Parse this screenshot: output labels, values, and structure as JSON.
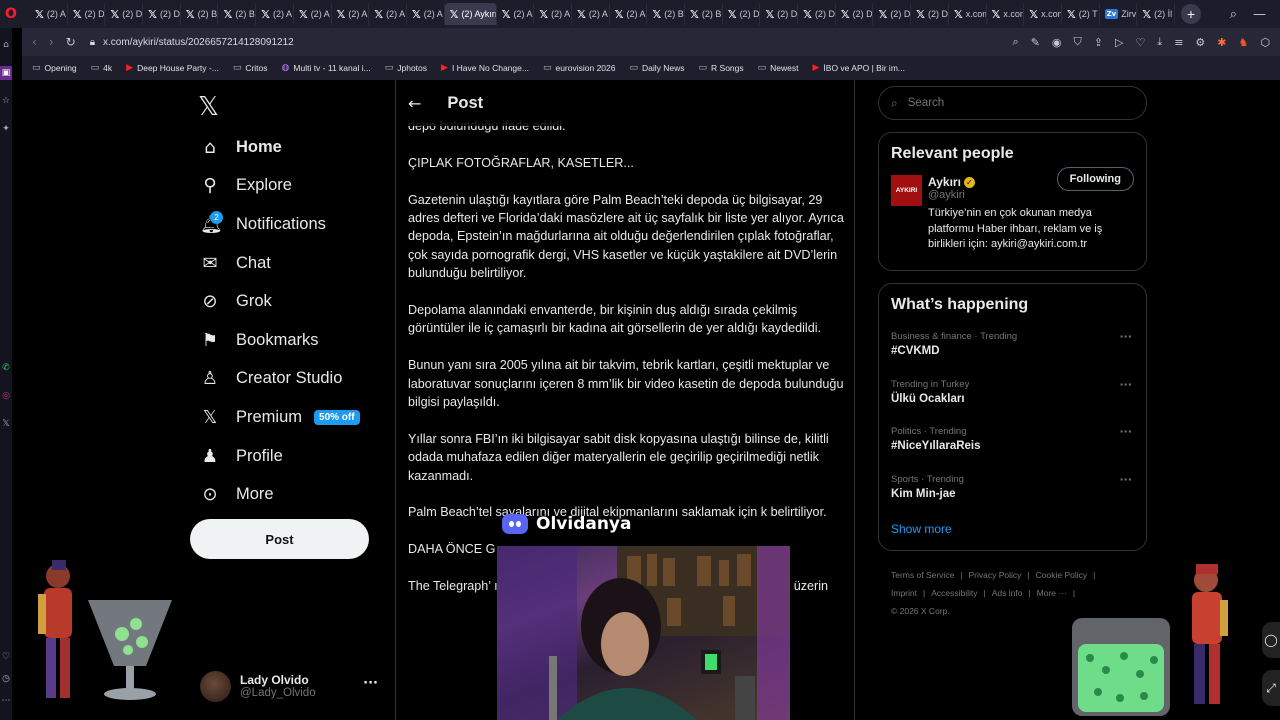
{
  "browser": {
    "tabs": [
      {
        "label": "(2) A"
      },
      {
        "label": "(2) D"
      },
      {
        "label": "(2) D"
      },
      {
        "label": "(2) D"
      },
      {
        "label": "(2) B"
      },
      {
        "label": "(2) B"
      },
      {
        "label": "(2) A"
      },
      {
        "label": "(2) A"
      },
      {
        "label": "(2) A"
      },
      {
        "label": "(2) A"
      },
      {
        "label": "(2) A"
      },
      {
        "label": "(2) Aykırı",
        "active": true
      },
      {
        "label": "(2) A"
      },
      {
        "label": "(2) A"
      },
      {
        "label": "(2) A"
      },
      {
        "label": "(2) A"
      },
      {
        "label": "(2) B"
      },
      {
        "label": "(2) B"
      },
      {
        "label": "(2) D"
      },
      {
        "label": "(2) D"
      },
      {
        "label": "(2) D"
      },
      {
        "label": "(2) D"
      },
      {
        "label": "(2) D"
      },
      {
        "label": "(2) D"
      },
      {
        "label": "x.com"
      },
      {
        "label": "x.com"
      },
      {
        "label": "x.com"
      },
      {
        "label": "(2) T"
      },
      {
        "label": "Zirve",
        "blue": true
      },
      {
        "label": "(2) İl"
      }
    ],
    "url": "x.com/aykiri/status/2026657214128091212",
    "bookmarks": [
      {
        "label": "Opening",
        "icon": "folder"
      },
      {
        "label": "4k",
        "icon": "folder"
      },
      {
        "label": "Deep House Party -...",
        "icon": "youtube"
      },
      {
        "label": "Critos",
        "icon": "folder"
      },
      {
        "label": "Multi tv - 11 kanal i...",
        "icon": "vk"
      },
      {
        "label": "Jphotos",
        "icon": "folder"
      },
      {
        "label": "I Have No Change...",
        "icon": "youtube"
      },
      {
        "label": "eurovision 2026",
        "icon": "folder"
      },
      {
        "label": "Daily News",
        "icon": "folder"
      },
      {
        "label": "R Songs",
        "icon": "folder"
      },
      {
        "label": "Newest",
        "icon": "folder"
      },
      {
        "label": "İBO ve APO | Bir im...",
        "icon": "youtube"
      }
    ]
  },
  "nav": {
    "items": [
      {
        "label": "Home",
        "icon": "home-icon",
        "active": true
      },
      {
        "label": "Explore",
        "icon": "search-icon"
      },
      {
        "label": "Notifications",
        "icon": "bell-icon",
        "badge": "2"
      },
      {
        "label": "Chat",
        "icon": "mail-icon"
      },
      {
        "label": "Grok",
        "icon": "grok-icon"
      },
      {
        "label": "Bookmarks",
        "icon": "bookmark-icon"
      },
      {
        "label": "Creator Studio",
        "icon": "creator-icon"
      },
      {
        "label": "Premium",
        "icon": "x-icon",
        "promo": "50% off"
      },
      {
        "label": "Profile",
        "icon": "person-icon"
      },
      {
        "label": "More",
        "icon": "more-circle-icon"
      }
    ],
    "post_label": "Post",
    "account": {
      "name": "Lady Olvido",
      "handle": "@Lady_Olvido"
    }
  },
  "main": {
    "title": "Post",
    "paragraphs": [
      "depo bulunduğu ifade edildi.",
      "ÇIPLAK FOTOĞRAFLAR, KASETLER...",
      "Gazetenin ulaştığı kayıtlara göre Palm Beach’teki depoda üç bilgisayar, 29 adres defteri ve Florida’daki masözlere ait üç sayfalık bir liste yer alıyor. Ayrıca depoda, Epstein’ın mağdurlarına ait olduğu değerlendirilen çıplak fotoğraflar, çok sayıda pornografik dergi, VHS kasetler ve küçük yaştakilere ait DVD’lerin bulunduğu belirtiliyor.",
      "Depolama alanındaki envanterde, bir kişinin duş aldığı sırada çekilmiş görüntüler ile iç çamaşırlı bir kadına ait görsellerin de yer aldığı kaydedildi.",
      "Bunun yanı sıra 2005 yılına ait bir takvim, tebrik kartları, çeşitli mektuplar ve laboratuvar sonuçlarını içeren 8 mm’lik bir video kasetin de depoda bulunduğu bilgisi paylaşıldı.",
      "Yıllar sonra FBI’ın iki bilgisayar sabit disk kopyasına ulaştığı bilinse de, kilitli odada muhafaza edilen diğer materyallerin ele geçirilip geçirilmediği netlik kazanmadı.",
      "Palm Beach’tel                            sayalarını ve dijital ekipmanlarını saklamak için k                                                          belirtiliyor.",
      "DAHA ÖNCE G",
      "The Telegraph’                                                    ının söz konusu depola                                                   rda Epstein ile bağl                                                        ği ihtimali üzerin"
    ]
  },
  "right": {
    "search_placeholder": "Search",
    "relevant_title": "Relevant people",
    "person": {
      "avatar_text": "AYKIRI",
      "name": "Aykırı",
      "handle": "@aykiri",
      "bio": "Türkiye’nin en çok okunan medya platformu Haber ihbarı, reklam ve iş birlikleri için: aykiri@aykiri.com.tr",
      "follow_label": "Following"
    },
    "happening_title": "What’s happening",
    "trends": [
      {
        "meta": "Business & finance · Trending",
        "name": "#CVKMD"
      },
      {
        "meta": "Trending in Turkey",
        "name": "Ülkü Ocakları"
      },
      {
        "meta": "Politics · Trending",
        "name": "#NiceYıllaraReis"
      },
      {
        "meta": "Sports · Trending",
        "name": "Kim Min-jae"
      }
    ],
    "show_more": "Show more",
    "footer": {
      "links_row1": [
        "Terms of Service",
        "Privacy Policy",
        "Cookie Policy"
      ],
      "links_row2": [
        "Imprint",
        "Accessibility",
        "Ads info",
        "More ···"
      ],
      "copyright": "© 2026 X Corp."
    }
  },
  "overlay": {
    "discord_name": "Olvidanya"
  },
  "colors": {
    "accent": "#1d9bf0",
    "background": "#000000",
    "border": "#2f3336",
    "muted_text": "#71767b"
  }
}
